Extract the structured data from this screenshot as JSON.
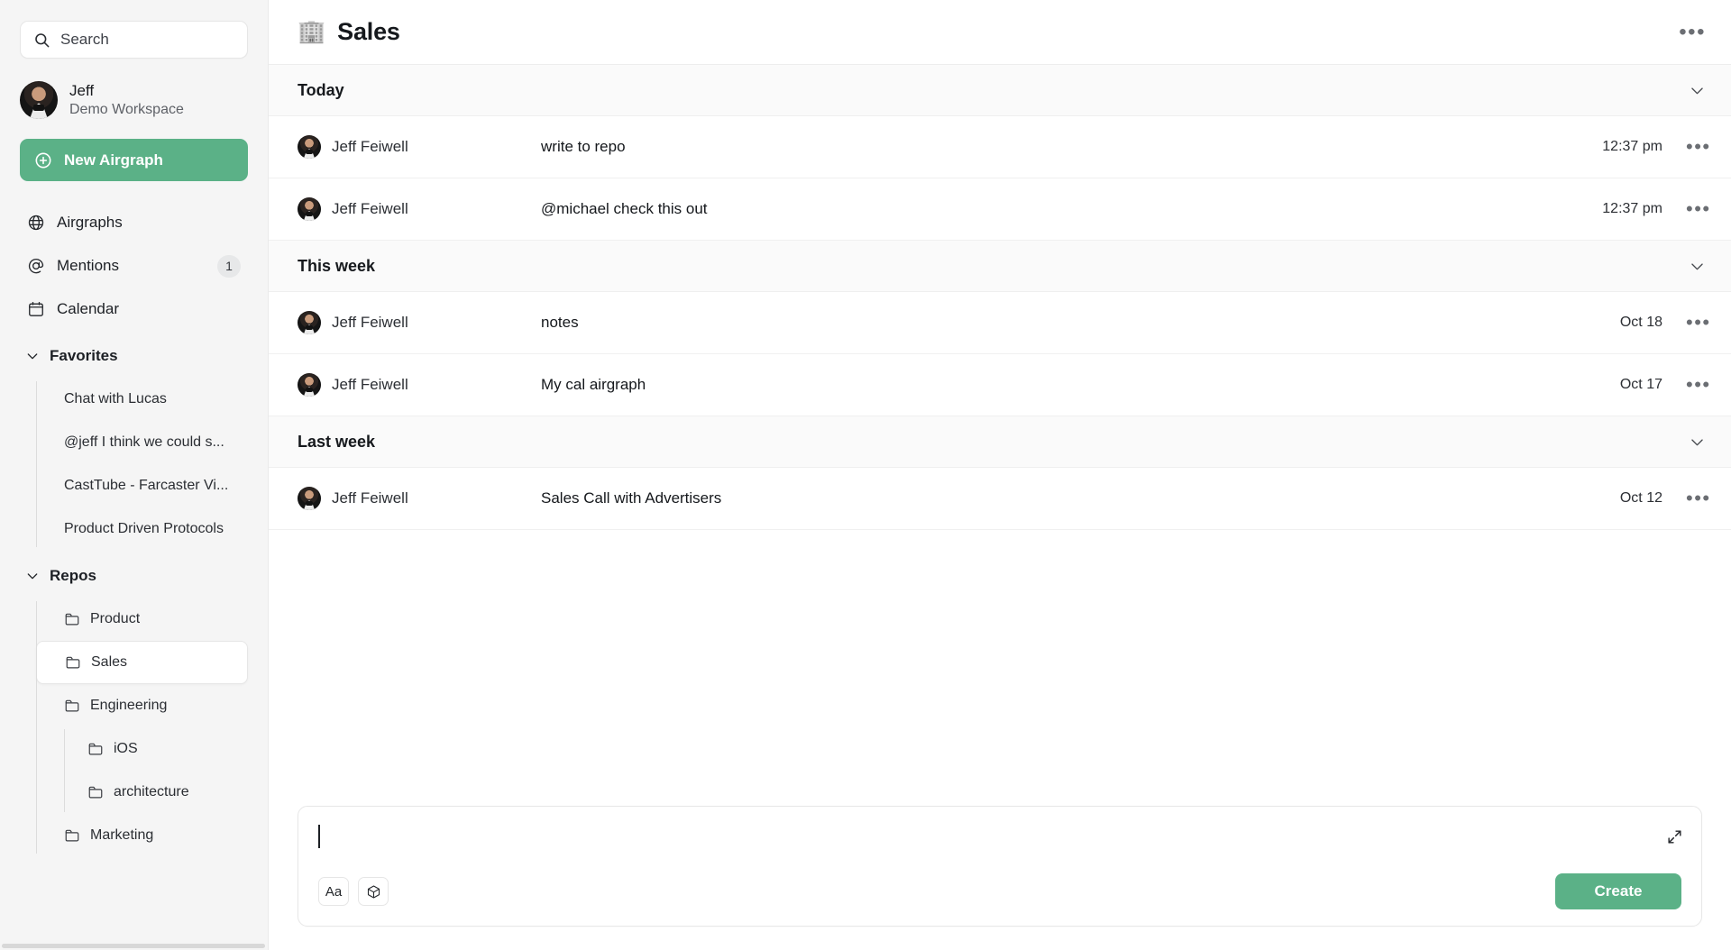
{
  "sidebar": {
    "search": {
      "placeholder": "Search",
      "icon": "search-icon"
    },
    "profile": {
      "name": "Jeff",
      "workspace": "Demo Workspace",
      "avatar": "avatar-jeff"
    },
    "new_button": {
      "label": "New Airgraph",
      "icon": "plus-circle-icon",
      "color": "#5bb187"
    },
    "nav": [
      {
        "label": "Airgraphs",
        "icon": "globe-icon",
        "badge": null
      },
      {
        "label": "Mentions",
        "icon": "at-sign-icon",
        "badge": "1"
      },
      {
        "label": "Calendar",
        "icon": "calendar-icon",
        "badge": null
      }
    ],
    "favorites": {
      "label": "Favorites",
      "icon": "chevron-down-icon",
      "items": [
        {
          "label": "Chat with Lucas"
        },
        {
          "label": "@jeff I think we could s..."
        },
        {
          "label": "CastTube - Farcaster Vi..."
        },
        {
          "label": "Product Driven Protocols"
        }
      ]
    },
    "repos": {
      "label": "Repos",
      "icon": "chevron-down-icon",
      "items": [
        {
          "label": "Product",
          "icon": "folder-icon",
          "selected": false
        },
        {
          "label": "Sales",
          "icon": "folder-icon",
          "selected": true
        },
        {
          "label": "Engineering",
          "icon": "folder-icon",
          "selected": false
        }
      ],
      "engineering_children": [
        {
          "label": "iOS",
          "icon": "folder-icon"
        },
        {
          "label": "architecture",
          "icon": "folder-icon"
        }
      ],
      "trailing": [
        {
          "label": "Marketing",
          "icon": "folder-icon"
        }
      ]
    }
  },
  "header": {
    "icon": "office-building-icon",
    "title": "Sales",
    "menu_icon": "ellipsis-icon"
  },
  "sections": [
    {
      "label": "Today",
      "rows": [
        {
          "user": "Jeff Feiwell",
          "title": "write to repo",
          "time": "12:37 pm"
        },
        {
          "user": "Jeff Feiwell",
          "title": "@michael check this out",
          "time": "12:37 pm"
        }
      ]
    },
    {
      "label": "This week",
      "rows": [
        {
          "user": "Jeff Feiwell",
          "title": "notes",
          "time": "Oct 18"
        },
        {
          "user": "Jeff Feiwell",
          "title": "My cal airgraph",
          "time": "Oct 17"
        }
      ]
    },
    {
      "label": "Last week",
      "rows": [
        {
          "user": "Jeff Feiwell",
          "title": "Sales Call with Advertisers",
          "time": "Oct 12"
        }
      ]
    }
  ],
  "composer": {
    "value": "",
    "expand_icon": "expand-arrows-icon",
    "tools": [
      {
        "label": "Aa",
        "name": "format-text-button"
      },
      {
        "label": "",
        "name": "cube-block-button"
      }
    ],
    "create_label": "Create",
    "create_color": "#5bb187"
  },
  "row_menu_icon": "ellipsis-icon"
}
